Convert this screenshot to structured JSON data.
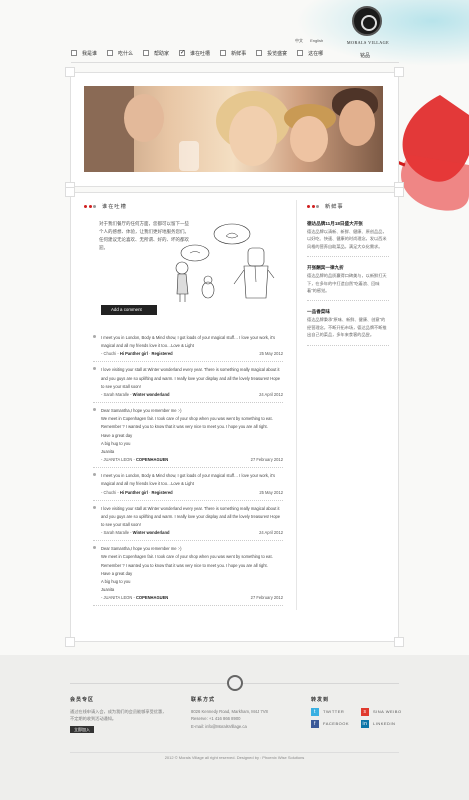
{
  "header": {
    "brand": "MORALS VILLAGE",
    "brand_sig": "铭品",
    "lang": [
      "中文",
      "English"
    ]
  },
  "nav": [
    {
      "label": "我是谁",
      "active": false
    },
    {
      "label": "吃什么",
      "active": false
    },
    {
      "label": "帮助家",
      "active": false
    },
    {
      "label": "谁在吐槽",
      "active": true
    },
    {
      "label": "新鲜事",
      "active": false
    },
    {
      "label": "投览盛宴",
      "active": false
    },
    {
      "label": "这在哪",
      "active": false
    }
  ],
  "main": {
    "section_title": "谁在吐槽",
    "intro": "对于我们餐厅的任何方面，您都可以留下一些个人的感想、体验，让我们更好地服务您们。任何建议无论喜欢、无所谓、好的、坏的都欢迎。",
    "add_comment": "Add a comment"
  },
  "comments": [
    {
      "lines": [
        "I meet you in London, Body & Mind show, I got loads of your magical stuff… I love your work, it's",
        "magical and all my friends love it too…Love & Light"
      ],
      "author": "- Chuchi",
      "title": "Hi Panther girl",
      "tag": "Registered",
      "date": "25 May 2012"
    },
    {
      "lines": [
        "I love visiting your stall at Winter wonderland every year. There is something really magical about it",
        "and you guys are so uplifting and warm. I really love your display and all the lovely treasures! Hope",
        "to see your stall soon!"
      ],
      "author": "- Sarah Maralle",
      "title": "Winter wonderland",
      "tag": "",
      "date": "24 April 2012"
    },
    {
      "lines": [
        "Dear Samantha,I hope you remember me :-)",
        "We meet in Copenhagen fair. I took care of your shop when you was went by something to eat.",
        "Remember ? I wanted you to know that it was very nice to meet you. I hope you are all right.",
        "Have a great day",
        "A big hug to you",
        "Juanita"
      ],
      "author": "- JUANITA LEON",
      "title": "COPENHAGUEN",
      "tag": "",
      "date": "27 February 2012"
    },
    {
      "lines": [
        "I meet you in London, Body & Mind show, I got loads of your magical stuff… I love your work, it's",
        "magical and all my friends love it too…Love & Light"
      ],
      "author": "- Chuchi",
      "title": "Hi Panther girl",
      "tag": "Registered",
      "date": "25 May 2012"
    },
    {
      "lines": [
        "I love visiting your stall at Winter wonderland every year. There is something really magical about it",
        "and you guys are so uplifting and warm. I really love your display and all the lovely treasures! Hope",
        "to see your stall soon!"
      ],
      "author": "- Sarah Maralle",
      "title": "Winter wonderland",
      "tag": "",
      "date": "24 April 2012"
    },
    {
      "lines": [
        "Dear Samantha,I hope you remember me :-)",
        "We meet in Copenhagen fair. I took care of your shop when you was went by something to eat.",
        "Remember ? I wanted you to know that it was very nice to meet you. I hope you are all right.",
        "Have a great day",
        "A big hug to you",
        "Juanita"
      ],
      "author": "- JUANITA LEON",
      "title": "COPENHAGUEN",
      "tag": "",
      "date": "27 February 2012"
    }
  ],
  "sidebar": {
    "title": "新鲜事",
    "news": [
      {
        "title": "德达品牌11月18日盛大开张",
        "body": "德达品牌以清新、新鲜、健康、原创品品，以好吃、快速、健康的时尚理念，发以西米风格的营养自助菜品，满足大众化需求。"
      },
      {
        "title": "开张酬宾一律九折",
        "body": "德达品牌的品质赢得口碑美与，以新鲜打天下，在多年的中打造自然“吃着浪、回味着”的感觉。"
      },
      {
        "title": "一品香菜味",
        "body": "德达品牌秉承“原味、新鲜、健康、创意”的经营理念，不断开拓市场，德达品牌不断推出自己的菜品，多年来食客的品尝。"
      }
    ]
  },
  "footer": {
    "member": {
      "title": "会员专区",
      "text": "通过在线申请入会，成为我们的会员能够享受优惠，不定期的收到活动通知。",
      "button": "立即加入"
    },
    "contact": {
      "title": "联系方式",
      "address": "8026 Kennedy Road, Markham, M4J 7V8",
      "phone": "Reserve: +1 416 866 8900",
      "email": "E-mail: info@MoralsVillage.ca"
    },
    "share": {
      "title": "转发到",
      "items": [
        {
          "label": "TWITTER",
          "color": "#3ab0e2",
          "glyph": "t"
        },
        {
          "label": "SINA WEIBO",
          "color": "#e03a2e",
          "glyph": "s"
        },
        {
          "label": "FACEBOOK",
          "color": "#3b5998",
          "glyph": "f"
        },
        {
          "label": "LINKEDIN",
          "color": "#0e76a8",
          "glyph": "in"
        }
      ]
    },
    "copyright": "2012 © Morals Village all right reserved.   Designed by : Phoenix Wise Solutions"
  }
}
